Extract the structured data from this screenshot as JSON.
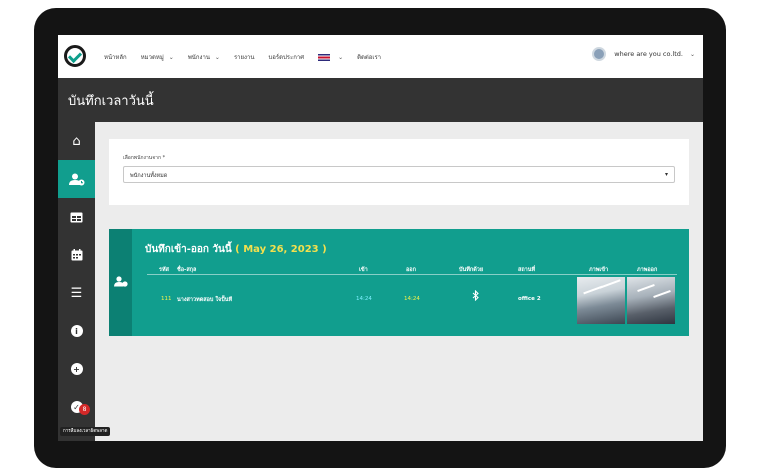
{
  "nav": {
    "items": [
      {
        "label": "หน้าหลัก",
        "dropdown": false
      },
      {
        "label": "หมวดหมู่",
        "dropdown": true
      },
      {
        "label": "พนักงาน",
        "dropdown": true
      },
      {
        "label": "รายงาน",
        "dropdown": false
      },
      {
        "label": "บอร์ดประกาศ",
        "dropdown": false
      },
      {
        "label": "",
        "dropdown": true,
        "flag": true
      },
      {
        "label": "ติดต่อเรา",
        "dropdown": false
      }
    ],
    "user_name": "where are you co.ltd."
  },
  "page": {
    "title": "บันทึกเวลาวันนี้"
  },
  "sidebar": {
    "items": [
      {
        "icon": "home-icon",
        "glyph": "⌂"
      },
      {
        "icon": "user-clock-icon",
        "glyph": "👤"
      },
      {
        "icon": "table-icon",
        "glyph": "▦"
      },
      {
        "icon": "calendar-icon",
        "glyph": "▤"
      },
      {
        "icon": "menu-icon",
        "glyph": "☰"
      },
      {
        "icon": "info-icon",
        "glyph": "i"
      },
      {
        "icon": "plus-circle-icon",
        "glyph": "+"
      },
      {
        "icon": "check-circle-icon",
        "glyph": "✓"
      }
    ],
    "badge": "8",
    "tooltip": "การลืมลงเวลาผิดพลาด"
  },
  "filter": {
    "label": "เลือกพนักงานจาก *",
    "value": "พนักงานทั้งหมด"
  },
  "log": {
    "title": "บันทึกเข้า-ออก วันนี้",
    "date": "( May 26, 2023 )",
    "headers": [
      "รหัส",
      "ชื่อ-สกุล",
      "เข้า",
      "ออก",
      "บันทึกด้วย",
      "สถานที่",
      "ภาพเข้า",
      "ภาพออก"
    ],
    "rows": [
      {
        "id": "111",
        "name": "นางสาวทดสอบ ใจปั้นที",
        "in": "14:24",
        "out": "14:24",
        "method_icon": "bluetooth-icon",
        "place": "office 2"
      }
    ]
  },
  "colors": {
    "accent": "#119e8e",
    "dark": "#333333",
    "date": "#f4e04d"
  }
}
